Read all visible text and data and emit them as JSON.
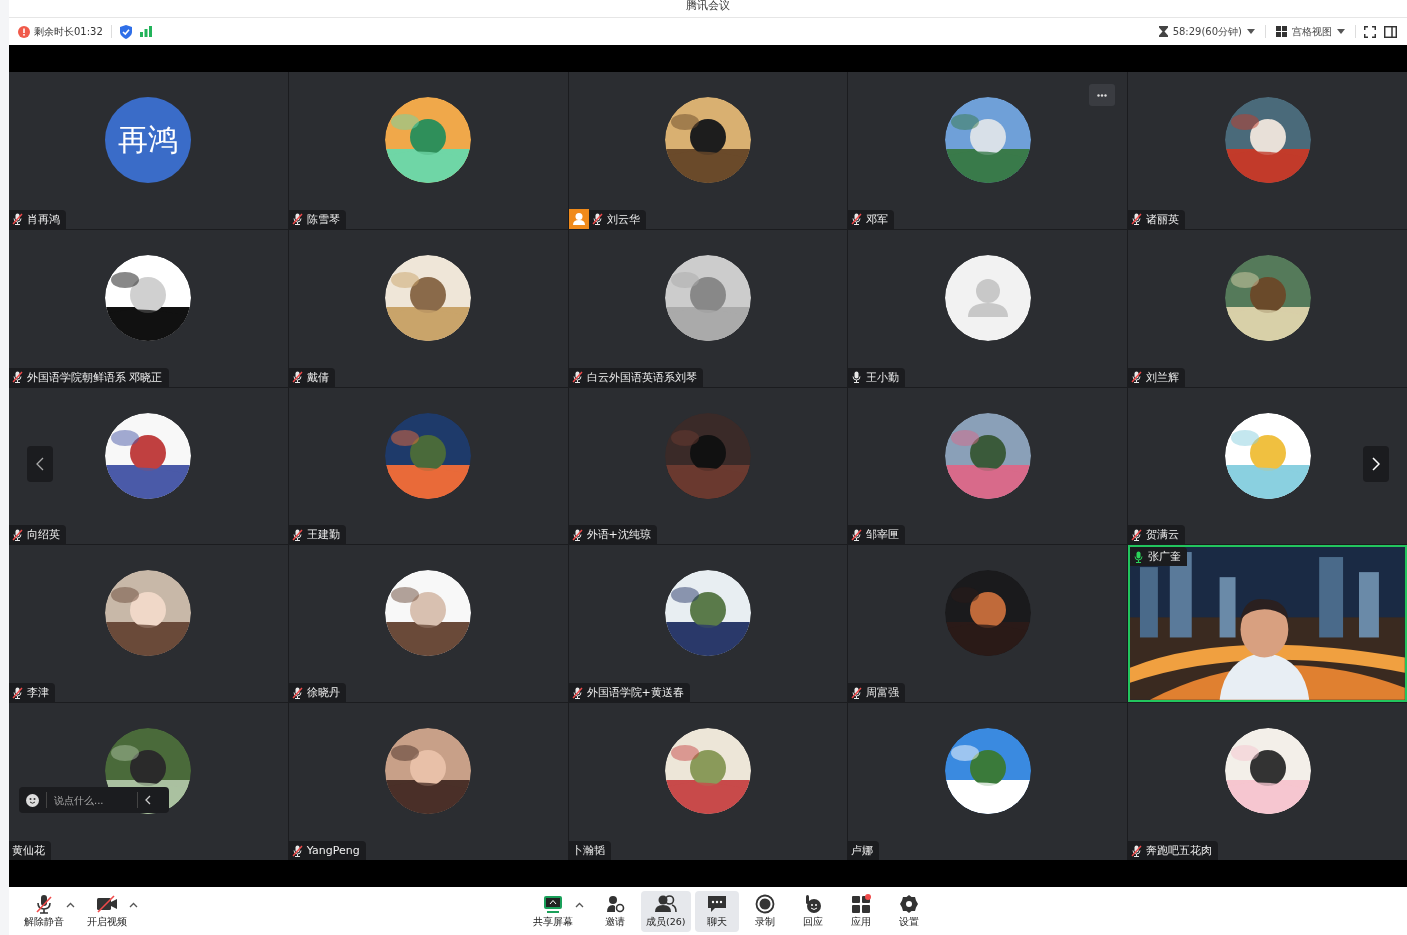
{
  "window": {
    "title": "腾讯会议"
  },
  "top_bar": {
    "remaining": "剩余时长01:32",
    "timer": "58:29(60分钟)",
    "view": "宫格视图"
  },
  "tiles": [
    {
      "name": "肖再鸿",
      "muted": true,
      "kind": "text",
      "avatar_text": "再鸿",
      "selected": false
    },
    {
      "name": "陈雪琴",
      "muted": true,
      "kind": "picture",
      "selected": false
    },
    {
      "name": "刘云华",
      "muted": true,
      "kind": "picture",
      "host": true,
      "selected": false
    },
    {
      "name": "邓军",
      "muted": true,
      "kind": "picture",
      "more": true,
      "selected": false
    },
    {
      "name": "诸丽英",
      "muted": true,
      "kind": "picture",
      "selected": false
    },
    {
      "name": "外国语学院朝鲜语系 邓晓正",
      "muted": true,
      "kind": "picture",
      "selected": false
    },
    {
      "name": "戴倩",
      "muted": true,
      "kind": "picture",
      "selected": false
    },
    {
      "name": "白云外国语英语系刘琴",
      "muted": true,
      "kind": "picture",
      "selected": false
    },
    {
      "name": "王小勤",
      "muted": false,
      "kind": "placeholder",
      "selected": false
    },
    {
      "name": "刘兰辉",
      "muted": true,
      "kind": "picture",
      "selected": false
    },
    {
      "name": "向绍英",
      "muted": true,
      "kind": "picture",
      "selected": false
    },
    {
      "name": "王建勤",
      "muted": true,
      "kind": "picture",
      "selected": false
    },
    {
      "name": "外语+沈纯琼",
      "muted": true,
      "kind": "picture",
      "selected": false
    },
    {
      "name": "邹宰匣",
      "muted": true,
      "kind": "picture",
      "selected": false
    },
    {
      "name": "贺满云",
      "muted": true,
      "kind": "picture",
      "selected": false
    },
    {
      "name": "李津",
      "muted": true,
      "kind": "picture",
      "selected": false
    },
    {
      "name": "徐晓丹",
      "muted": true,
      "kind": "picture",
      "selected": false
    },
    {
      "name": "外国语学院+黄送春",
      "muted": true,
      "kind": "picture",
      "selected": false
    },
    {
      "name": "周富强",
      "muted": true,
      "kind": "picture",
      "selected": false
    },
    {
      "name": "张广奎",
      "muted": false,
      "speaking": true,
      "kind": "video",
      "selected": true
    },
    {
      "name": "黄仙花",
      "kind": "picture",
      "selected": false
    },
    {
      "name": "YangPeng",
      "muted": true,
      "kind": "picture",
      "selected": false
    },
    {
      "name": "卜瀚韬",
      "kind": "picture",
      "selected": false
    },
    {
      "name": "卢娜",
      "kind": "picture",
      "selected": false
    },
    {
      "name": "奔跑吧五花肉",
      "muted": true,
      "kind": "picture",
      "selected": false
    }
  ],
  "chat_box": {
    "placeholder": "说点什么..."
  },
  "toolbar_left": [
    {
      "kind": "mic",
      "label": "解除静音",
      "has_menu": true,
      "selected": false
    },
    {
      "kind": "camera",
      "label": "开启视频",
      "has_menu": true,
      "selected": false
    }
  ],
  "toolbar_center": [
    {
      "kind": "share",
      "label": "共享屏幕",
      "has_menu": true,
      "selected": false
    },
    {
      "kind": "invite",
      "label": "邀请",
      "has_menu": false,
      "selected": false
    },
    {
      "kind": "members",
      "label": "成员(26)",
      "has_menu": false,
      "selected": true
    },
    {
      "kind": "chat",
      "label": "聊天",
      "has_menu": false,
      "selected": true
    },
    {
      "kind": "record",
      "label": "录制",
      "has_menu": false,
      "selected": false
    },
    {
      "kind": "react",
      "label": "回应",
      "has_menu": false,
      "selected": false
    },
    {
      "kind": "apps",
      "label": "应用",
      "has_menu": false,
      "selected": false
    },
    {
      "kind": "settings",
      "label": "设置",
      "has_menu": false,
      "selected": false
    }
  ]
}
